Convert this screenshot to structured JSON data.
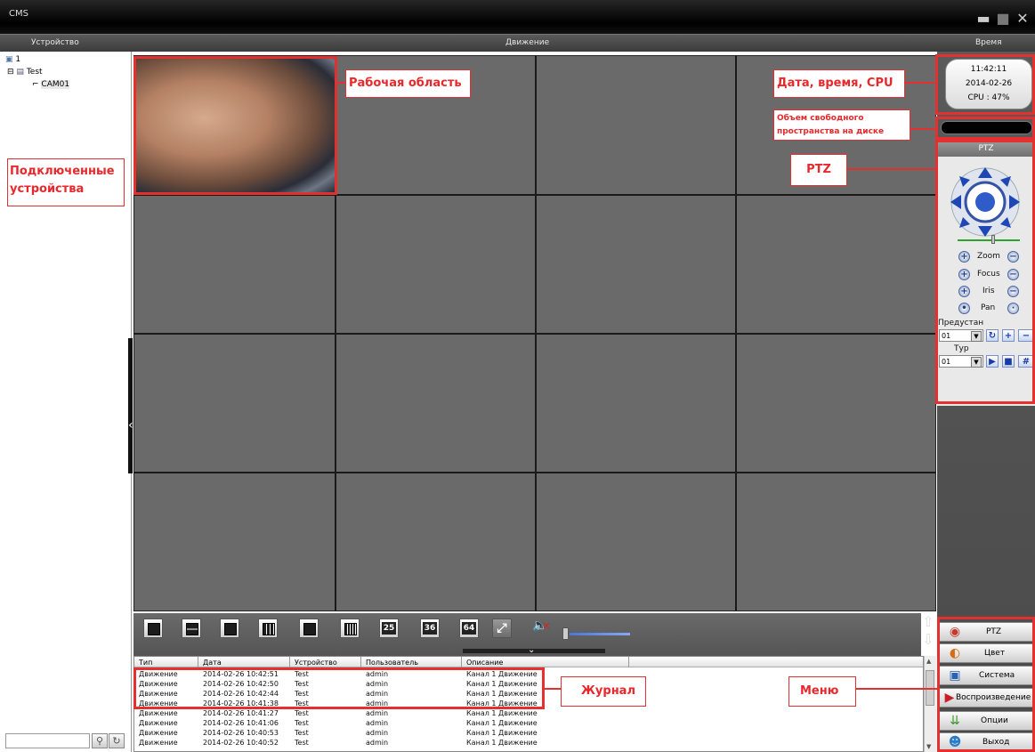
{
  "window": {
    "title": "CMS"
  },
  "header": {
    "device": "Устройство",
    "motion": "Движение",
    "time": "Время"
  },
  "tree": {
    "root": "1",
    "group": "Test",
    "camera": "CAM01"
  },
  "clock": {
    "time": "11:42:11",
    "date": "2014-02-26",
    "cpu": "CPU : 47%"
  },
  "ptz": {
    "title": "PTZ",
    "zoom": "Zoom",
    "focus": "Focus",
    "iris": "Iris",
    "pan": "Pan",
    "preset_label": "Предустан",
    "preset_value": "01",
    "tour_label": "Тур",
    "tour_value": "01"
  },
  "toolbar": {
    "layouts": [
      "",
      "",
      "",
      "",
      "",
      "",
      "25",
      "36",
      "64"
    ]
  },
  "log": {
    "columns": [
      "Тип",
      "Дата",
      "Устройство",
      "Пользователь",
      "Описание"
    ],
    "rows": [
      [
        "Движение",
        "2014-02-26 10:42:51",
        "Test",
        "admin",
        "Канал 1 Движение"
      ],
      [
        "Движение",
        "2014-02-26 10:42:50",
        "Test",
        "admin",
        "Канал 1 Движение"
      ],
      [
        "Движение",
        "2014-02-26 10:42:44",
        "Test",
        "admin",
        "Канал 1 Движение"
      ],
      [
        "Движение",
        "2014-02-26 10:41:38",
        "Test",
        "admin",
        "Канал 1 Движение"
      ],
      [
        "Движение",
        "2014-02-26 10:41:27",
        "Test",
        "admin",
        "Канал 1 Движение"
      ],
      [
        "Движение",
        "2014-02-26 10:41:06",
        "Test",
        "admin",
        "Канал 1 Движение"
      ],
      [
        "Движение",
        "2014-02-26 10:40:53",
        "Test",
        "admin",
        "Канал 1 Движение"
      ],
      [
        "Движение",
        "2014-02-26 10:40:52",
        "Test",
        "admin",
        "Канал 1 Движение"
      ]
    ]
  },
  "menu": {
    "ptz": "PTZ",
    "color": "Цвет",
    "system": "Система",
    "playback": "Воспроизведение",
    "options": "Опции",
    "exit": "Выход"
  },
  "annotations": {
    "workspace": "Рабочая область",
    "datetime": "Дата, время, CPU",
    "disk": "Объем свободного пространства на диске",
    "ptz": "PTZ",
    "devices": "Подключенные устройства",
    "log": "Журнал",
    "menu": "Меню"
  },
  "colors": {
    "annotation": "#e53030",
    "grid_bg": "#6a6a6a",
    "volume": "#4a76d8"
  }
}
